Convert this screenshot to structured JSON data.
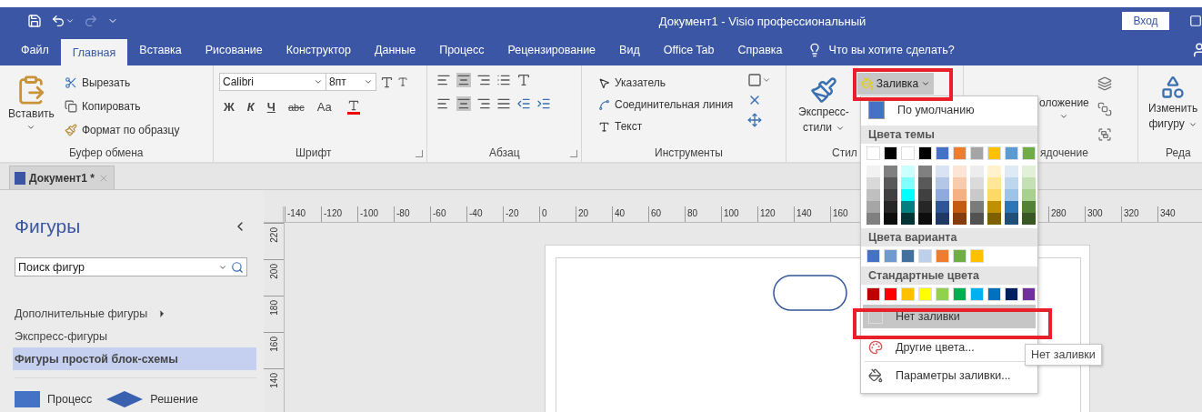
{
  "window": {
    "title": "Документ1  -  Visio профессиональный",
    "sign_in": "Вход"
  },
  "tabs": [
    {
      "label": "Файл",
      "selected": false
    },
    {
      "label": "Главная",
      "selected": true
    },
    {
      "label": "Вставка",
      "selected": false
    },
    {
      "label": "Рисование",
      "selected": false
    },
    {
      "label": "Конструктор",
      "selected": false
    },
    {
      "label": "Данные",
      "selected": false
    },
    {
      "label": "Процесс",
      "selected": false
    },
    {
      "label": "Рецензирование",
      "selected": false
    },
    {
      "label": "Вид",
      "selected": false
    },
    {
      "label": "Office Tab",
      "selected": false
    },
    {
      "label": "Справка",
      "selected": false
    }
  ],
  "tell_me": "Что вы хотите сделать?",
  "ribbon": {
    "clipboard": {
      "paste": "Вставить",
      "cut": "Вырезать",
      "copy": "Копировать",
      "format_painter": "Формат по образцу",
      "label": "Буфер обмена"
    },
    "font": {
      "font_name": "Calibri",
      "font_size": "8пт",
      "bold": "Ж",
      "italic": "К",
      "underline": "Ч",
      "strike": "abc",
      "case": "Аа",
      "label": "Шрифт"
    },
    "paragraph": {
      "label": "Абзац"
    },
    "tools": {
      "pointer": "Указатель",
      "connector": "Соединительная линия",
      "text": "Текст",
      "label": "Инструменты"
    },
    "styles": {
      "quick_styles": [
        "Экспресс-",
        "стили"
      ],
      "fill": "Заливка",
      "label": "Стил"
    },
    "arrange": {
      "position": "оложение",
      "label": "ядочение"
    },
    "editing": {
      "change_shape": [
        "Изменить",
        "фигуру"
      ],
      "label": "Реда"
    }
  },
  "document_tab": {
    "title": "Документ1 *"
  },
  "shapes_panel": {
    "title": "Фигуры",
    "search": {
      "value": "Поиск фигур"
    },
    "items": [
      {
        "label": "Дополнительные фигуры",
        "submenu": true,
        "selected": false
      },
      {
        "label": "Экспресс-фигуры",
        "submenu": false,
        "selected": false
      },
      {
        "label": "Фигуры простой блок-схемы",
        "submenu": false,
        "selected": true
      }
    ],
    "stencil": [
      {
        "kind": "process",
        "label": "Процесс"
      },
      {
        "kind": "decision",
        "label": "Решение"
      }
    ]
  },
  "ruler": {
    "left_ticks": [
      "-140",
      "-120",
      "-100",
      "-80",
      "-60",
      "-40",
      "-20",
      "0",
      "20",
      "40",
      "60",
      "80",
      "100",
      "120",
      "140",
      "160"
    ],
    "right_ticks": [
      "280",
      "300",
      "320",
      "340"
    ],
    "vertical_ticks": [
      "220",
      "200",
      "180",
      "160",
      "140"
    ]
  },
  "fill_menu": {
    "items": [
      {
        "kind": "color_item",
        "label": "По умолчанию",
        "color": "#4472c4",
        "highlighted": false
      },
      {
        "kind": "header",
        "label": "Цвета темы"
      },
      {
        "kind": "theme_grid",
        "columns": [
          {
            "color": "#ffffff",
            "shades": [
              {
                "color": "#f2f2f2"
              },
              {
                "color": "#d9d9d9"
              },
              {
                "color": "#bfbfbf"
              },
              {
                "color": "#a6a6a6"
              },
              {
                "color": "#808080"
              }
            ]
          },
          {
            "color": "#000000",
            "shades": [
              {
                "color": "#808080"
              },
              {
                "color": "#595959"
              },
              {
                "color": "#404040"
              },
              {
                "color": "#262626"
              },
              {
                "color": "#0d0d0d"
              }
            ]
          },
          {
            "color": "#ffffff",
            "shades": [
              {
                "color": "#ccffff"
              },
              {
                "color": "#80ffff"
              },
              {
                "color": "#00ffff"
              },
              {
                "color": "#008080"
              },
              {
                "color": "#003333"
              }
            ]
          },
          {
            "color": "#000000",
            "shades": [
              {
                "color": "#808080"
              },
              {
                "color": "#595959"
              },
              {
                "color": "#404040"
              },
              {
                "color": "#262626"
              },
              {
                "color": "#0d0d0d"
              }
            ]
          },
          {
            "color": "#4472c4",
            "shades": [
              {
                "color": "#dae3f3"
              },
              {
                "color": "#b4c7e7"
              },
              {
                "color": "#8faadc"
              },
              {
                "color": "#2f5597"
              },
              {
                "color": "#1f3864"
              }
            ]
          },
          {
            "color": "#ed7d31",
            "shades": [
              {
                "color": "#fbe5d6"
              },
              {
                "color": "#f8cbad"
              },
              {
                "color": "#f4b183"
              },
              {
                "color": "#c55a11"
              },
              {
                "color": "#843c0c"
              }
            ]
          },
          {
            "color": "#a5a5a5",
            "shades": [
              {
                "color": "#ededed"
              },
              {
                "color": "#dbdbdb"
              },
              {
                "color": "#c9c9c9"
              },
              {
                "color": "#7b7b7b"
              },
              {
                "color": "#525252"
              }
            ]
          },
          {
            "color": "#ffc000",
            "shades": [
              {
                "color": "#fff2cc"
              },
              {
                "color": "#ffe699"
              },
              {
                "color": "#ffd966"
              },
              {
                "color": "#bf9000"
              },
              {
                "color": "#7f6000"
              }
            ]
          },
          {
            "color": "#5b9bd5",
            "shades": [
              {
                "color": "#deebf7"
              },
              {
                "color": "#bdd7ee"
              },
              {
                "color": "#9dc3e6"
              },
              {
                "color": "#2e75b6"
              },
              {
                "color": "#1f4e79"
              }
            ]
          },
          {
            "color": "#70ad47",
            "shades": [
              {
                "color": "#e2f0d9"
              },
              {
                "color": "#c5e0b4"
              },
              {
                "color": "#a9d18e"
              },
              {
                "color": "#548235"
              },
              {
                "color": "#385723"
              }
            ]
          }
        ]
      },
      {
        "kind": "header",
        "label": "Цвета варианта"
      },
      {
        "kind": "swatch_row",
        "swatches": [
          {
            "color": "#4472c4"
          },
          {
            "color": "#6f9ad0"
          },
          {
            "color": "#41719c"
          },
          {
            "color": "#bdd0eb"
          },
          {
            "color": "#ed7d31"
          },
          {
            "color": "#70ad47"
          },
          {
            "color": "#ffc000"
          }
        ]
      },
      {
        "kind": "header",
        "label": "Стандартные цвета"
      },
      {
        "kind": "swatch_row",
        "swatches": [
          {
            "color": "#c00000"
          },
          {
            "color": "#ff0000"
          },
          {
            "color": "#ffc000"
          },
          {
            "color": "#ffff00"
          },
          {
            "color": "#92d050"
          },
          {
            "color": "#00b050"
          },
          {
            "color": "#00b0f0"
          },
          {
            "color": "#0070c0"
          },
          {
            "color": "#002060"
          },
          {
            "color": "#7030a0"
          }
        ]
      },
      {
        "kind": "no_fill",
        "label": "Нет заливки",
        "highlighted": true
      },
      {
        "kind": "more_colors",
        "label": "Другие цвета...",
        "highlighted": false
      },
      {
        "kind": "fill_options",
        "label": "Параметры заливки...",
        "highlighted": false
      }
    ]
  },
  "tooltip": "Нет заливки"
}
